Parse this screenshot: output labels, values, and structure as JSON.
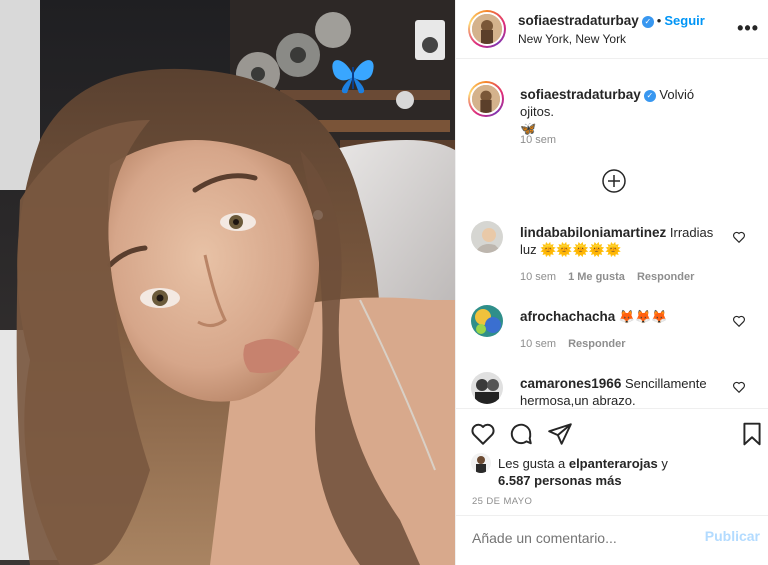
{
  "post": {
    "username": "sofiaestradaturbay",
    "verified_icon": "verified-badge-icon",
    "follow_label": "Seguir",
    "separator": "•",
    "location": "New York, New York",
    "more_icon": "more-options-icon",
    "more_glyph": "•••"
  },
  "caption": {
    "username": "sofiaestradaturbay",
    "text": "Volvió ojitos.",
    "emoji": "🦋",
    "time": "10 sem"
  },
  "load_more_icon": "plus-circle-icon",
  "comments": [
    {
      "username": "lindababiloniamartinez",
      "text": "Irradias luz 🌞🌞🌞🌞🌞",
      "time": "10 sem",
      "likes": "1 Me gusta",
      "reply": "Responder"
    },
    {
      "username": "afrochachacha",
      "text": "🦊🦊🦊",
      "time": "10 sem",
      "reply": "Responder"
    },
    {
      "username": "camarones1966",
      "text": "Sencillamente hermosa,un abrazo."
    }
  ],
  "actions": {
    "like_icon": "heart-icon",
    "comment_icon": "comment-bubble-icon",
    "share_icon": "paper-plane-icon",
    "save_icon": "bookmark-icon"
  },
  "likes": {
    "prefix": "Les gusta a",
    "user": "elpanterarojas",
    "joiner": "y",
    "others": "6.587 personas más"
  },
  "date": "25 DE MAYO",
  "add_comment": {
    "placeholder": "Añade un comentario...",
    "publish_label": "Publicar"
  },
  "colors": {
    "accent_blue": "#0095f6",
    "verified_blue": "#3897f0",
    "muted_text": "#8e8e8e",
    "publish_disabled": "#b3dbff"
  }
}
